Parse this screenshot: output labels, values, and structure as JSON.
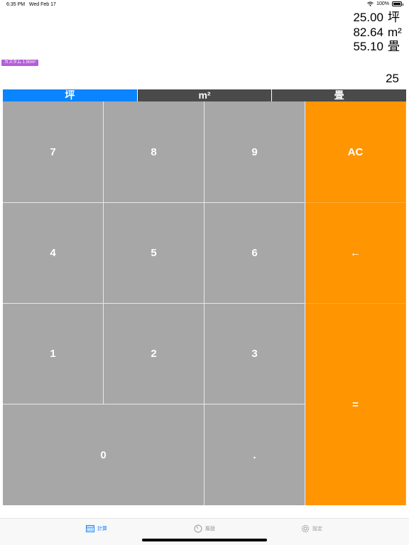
{
  "status": {
    "time": "6:35 PM",
    "date": "Wed Feb 17",
    "battery": "100%",
    "battery_level": 1.0
  },
  "results": [
    {
      "value": "25.00",
      "unit": "坪"
    },
    {
      "value": "82.64",
      "unit": "m²"
    },
    {
      "value": "55.10",
      "unit": "畳"
    }
  ],
  "custom_badge": "カスタム 1.50m²",
  "input_value": "25",
  "unit_tabs": [
    {
      "label": "坪",
      "active": true
    },
    {
      "label": "m²",
      "active": false
    },
    {
      "label": "畳",
      "active": false
    }
  ],
  "keys": {
    "k7": "7",
    "k8": "8",
    "k9": "9",
    "ac": "AC",
    "k4": "4",
    "k5": "5",
    "k6": "6",
    "back": "←",
    "k1": "1",
    "k2": "2",
    "k3": "3",
    "equals": "=",
    "k0": "0",
    "dot": "."
  },
  "tabs": [
    {
      "label": "計算",
      "icon": "calculator-icon",
      "active": true
    },
    {
      "label": "履歴",
      "icon": "history-icon",
      "active": false
    },
    {
      "label": "設定",
      "icon": "gear-icon",
      "active": false
    }
  ],
  "colors": {
    "accent": "#0a84ff",
    "operator": "#ff9500",
    "digit_key": "#a8a7a8",
    "tab_inactive": "#4a4a4a",
    "badge": "#b45fd6"
  }
}
